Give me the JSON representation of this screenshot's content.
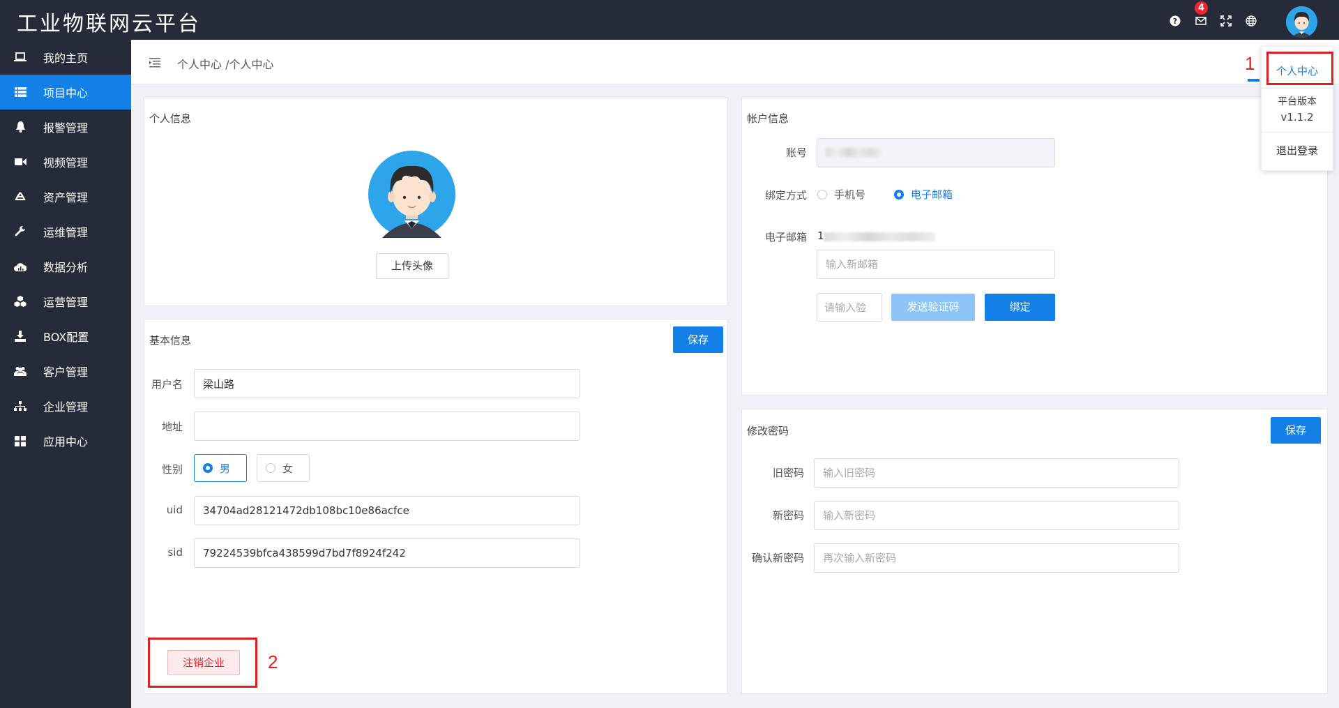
{
  "app": {
    "title": "工业物联网云平台",
    "notification_count": "4"
  },
  "sidebar": {
    "items": [
      {
        "label": "我的主页",
        "icon": "laptop-icon"
      },
      {
        "label": "项目中心",
        "icon": "list-icon"
      },
      {
        "label": "报警管理",
        "icon": "bell-icon"
      },
      {
        "label": "视频管理",
        "icon": "video-camera-icon"
      },
      {
        "label": "资产管理",
        "icon": "recycle-icon"
      },
      {
        "label": "运维管理",
        "icon": "wrench-icon"
      },
      {
        "label": "数据分析",
        "icon": "cloud-chart-icon"
      },
      {
        "label": "运营管理",
        "icon": "cubes-icon"
      },
      {
        "label": "BOX配置",
        "icon": "download-icon"
      },
      {
        "label": "客户管理",
        "icon": "users-icon"
      },
      {
        "label": "企业管理",
        "icon": "sitemap-icon"
      },
      {
        "label": "应用中心",
        "icon": "grid-icon"
      }
    ],
    "active_index": 1
  },
  "breadcrumb": "个人中心 /个人中心",
  "dropdown": {
    "personal_center": "个人中心",
    "version_label": "平台版本",
    "version_value": "v1.1.2",
    "logout": "退出登录"
  },
  "personal_info": {
    "title": "个人信息",
    "upload_avatar": "上传头像"
  },
  "basic_info": {
    "title": "基本信息",
    "save": "保存",
    "username_label": "用户名",
    "username_value": "梁山路",
    "address_label": "地址",
    "address_value": "",
    "gender_label": "性别",
    "gender_male": "男",
    "gender_female": "女",
    "gender_selected": "男",
    "uid_label": "uid",
    "uid_value": "34704ad28121472db108bc10e86acfce",
    "sid_label": "sid",
    "sid_value": "79224539bfca438599d7bd7f8924f242",
    "cancel_enterprise": "注销企业"
  },
  "account_info": {
    "title": "帐户信息",
    "account_label": "账号",
    "bind_label": "绑定方式",
    "bind_phone": "手机号",
    "bind_email": "电子邮箱",
    "bind_selected": "电子邮箱",
    "email_label": "电子邮箱",
    "email_value": "1",
    "new_email_placeholder": "输入新邮箱",
    "code_placeholder": "请输入验",
    "send_code": "发送验证码",
    "bind_button": "绑定"
  },
  "change_password": {
    "title": "修改密码",
    "save": "保存",
    "old_label": "旧密码",
    "old_placeholder": "输入旧密码",
    "new_label": "新密码",
    "new_placeholder": "输入新密码",
    "confirm_label": "确认新密码",
    "confirm_placeholder": "再次输入新密码"
  },
  "annotations": {
    "marker_1": "1",
    "marker_2": "2"
  },
  "colors": {
    "sidebar_bg": "#252b39",
    "accent": "#1380e8",
    "annotation_red": "#e02020",
    "danger": "#f5222d"
  }
}
